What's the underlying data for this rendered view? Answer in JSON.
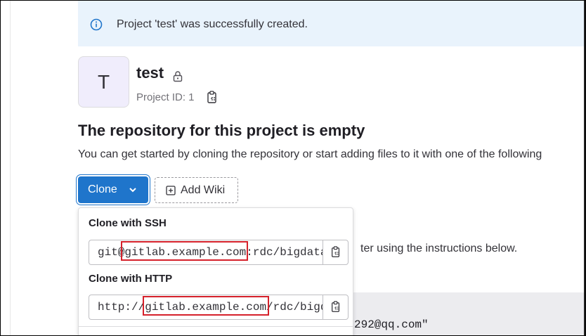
{
  "alert": {
    "message": "Project 'test' was successfully created.",
    "icon": "info-icon",
    "color": "#e9f3fc"
  },
  "project": {
    "avatar_letter": "T",
    "name": "test",
    "id_label": "Project ID: 1",
    "visibility_icon": "lock-icon"
  },
  "empty_repo": {
    "title": "The repository for this project is empty",
    "description": "You can get started by cloning the repository or start adding files to it with one of the following"
  },
  "actions": {
    "clone_label": "Clone",
    "add_wiki_label": "Add Wiki"
  },
  "clone_dropdown": {
    "ssh_heading": "Clone with SSH",
    "ssh_url": "git@gitlab.example.com:rdc/bigdata",
    "http_heading": "Clone with HTTP",
    "http_url": "http://gitlab.example.com/rdc/bigdata"
  },
  "background": {
    "instructions_fragment": "ter using the instructions below.",
    "code_fragment": "292@qq.com\""
  },
  "colors": {
    "primary": "#1f75cb",
    "highlight": "#d5212b"
  }
}
